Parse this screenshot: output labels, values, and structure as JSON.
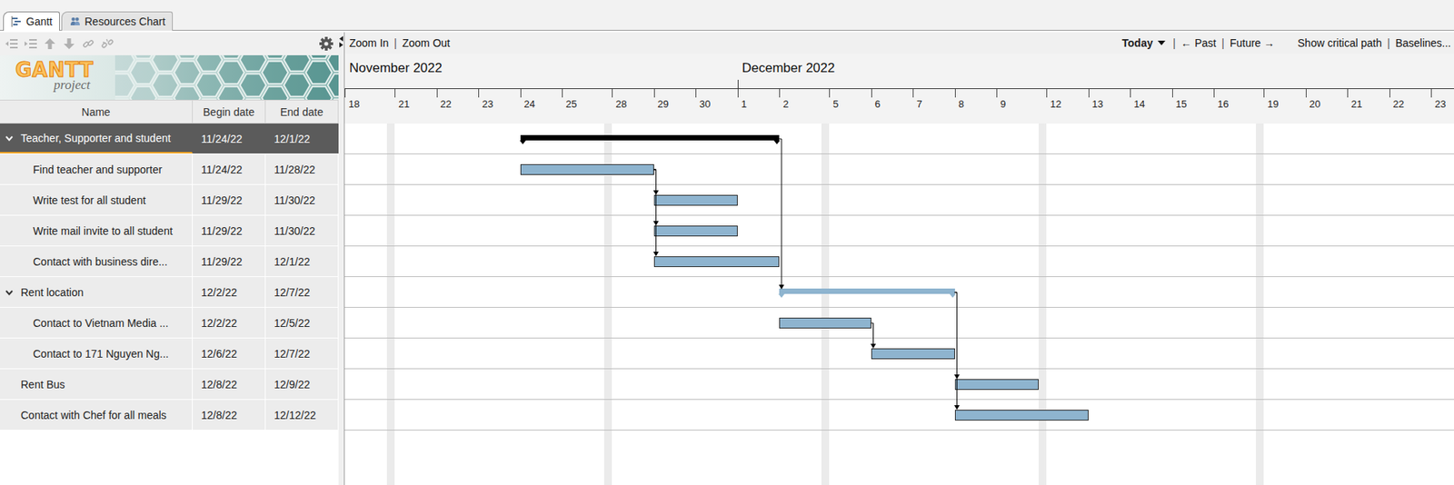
{
  "tabs": [
    {
      "label": "Gantt",
      "selected": true
    },
    {
      "label": "Resources Chart",
      "selected": false
    }
  ],
  "logo": {
    "title": "GANTT",
    "subtitle": "project"
  },
  "chart_toolbar": {
    "zoom": [
      "Zoom In",
      "Zoom Out"
    ],
    "today": "Today",
    "nav": [
      "← Past",
      "Future →"
    ],
    "views": [
      "Show critical path",
      "Baselines..."
    ],
    "separator": "|"
  },
  "table": {
    "columns": [
      "Name",
      "Begin date",
      "End date"
    ],
    "rows": [
      {
        "name": "Teacher, Supporter and student",
        "begin": "11/24/22",
        "end": "12/1/22",
        "kind": "group",
        "level": 0,
        "expanded": true,
        "selected": true
      },
      {
        "name": "Find teacher and supporter",
        "begin": "11/24/22",
        "end": "11/28/22",
        "kind": "task",
        "level": 1,
        "expanded": false,
        "selected": false
      },
      {
        "name": "Write test for all student",
        "begin": "11/29/22",
        "end": "11/30/22",
        "kind": "task",
        "level": 1,
        "expanded": false,
        "selected": false
      },
      {
        "name": "Write mail invite to all student",
        "begin": "11/29/22",
        "end": "11/30/22",
        "kind": "task",
        "level": 1,
        "expanded": false,
        "selected": false
      },
      {
        "name": "Contact with business dire...",
        "begin": "11/29/22",
        "end": "12/1/22",
        "kind": "task",
        "level": 1,
        "expanded": false,
        "selected": false
      },
      {
        "name": "Rent location",
        "begin": "12/2/22",
        "end": "12/7/22",
        "kind": "group",
        "level": 0,
        "expanded": true,
        "selected": false
      },
      {
        "name": "Contact to Vietnam Media ...",
        "begin": "12/2/22",
        "end": "12/5/22",
        "kind": "task",
        "level": 1,
        "expanded": false,
        "selected": false
      },
      {
        "name": "Contact to 171 Nguyen Ng...",
        "begin": "12/6/22",
        "end": "12/7/22",
        "kind": "task",
        "level": 1,
        "expanded": false,
        "selected": false
      },
      {
        "name": "Rent Bus",
        "begin": "12/8/22",
        "end": "12/9/22",
        "kind": "task",
        "level": 0,
        "expanded": false,
        "selected": false
      },
      {
        "name": "Contact with Chef for all meals",
        "begin": "12/8/22",
        "end": "12/12/22",
        "kind": "task",
        "level": 0,
        "expanded": false,
        "selected": false
      }
    ]
  },
  "timeline": {
    "months": [
      "November 2022",
      "December 2022"
    ],
    "days": [
      "18",
      "21",
      "22",
      "23",
      "24",
      "25",
      "28",
      "29",
      "30",
      "1",
      "2",
      "5",
      "6",
      "7",
      "8",
      "9",
      "12",
      "13",
      "14",
      "15",
      "16",
      "19",
      "20",
      "21",
      "22",
      "23"
    ]
  },
  "links": [
    {
      "from": 1,
      "to": 2
    },
    {
      "from": 1,
      "to": 3
    },
    {
      "from": 1,
      "to": 4
    },
    {
      "from": 0,
      "to": 5
    },
    {
      "from": 6,
      "to": 7
    },
    {
      "from": 5,
      "to": 8
    },
    {
      "from": 5,
      "to": 9
    }
  ]
}
